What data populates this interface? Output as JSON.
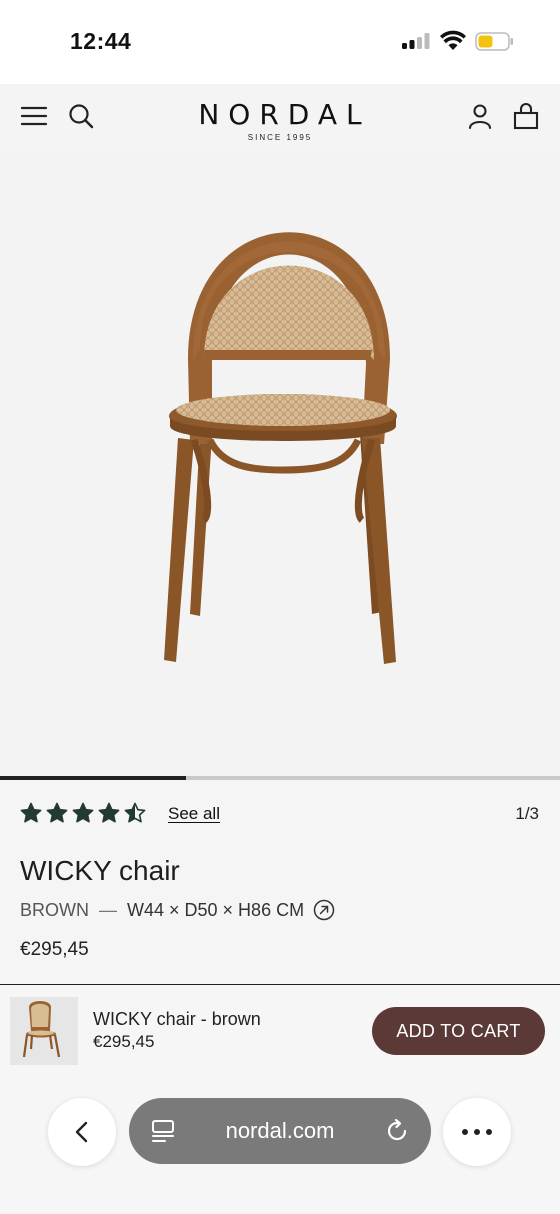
{
  "status_bar": {
    "time": "12:44"
  },
  "header": {
    "brand": "NORDAL",
    "tagline": "SINCE 1995",
    "icons": [
      "menu-icon",
      "search-icon",
      "account-icon",
      "bag-icon"
    ]
  },
  "gallery": {
    "current_page": 1,
    "total_pages": 3,
    "counter": "1/3",
    "progress": 0.333
  },
  "product": {
    "rating": 4.5,
    "rating_max": 5,
    "see_all": "See all",
    "name": "WICKY chair",
    "color": "BROWN",
    "separator": "—",
    "dimensions": "W44 × D50 × H86 CM",
    "price": "€295,45"
  },
  "cart_bar": {
    "name": "WICKY chair - brown",
    "price": "€295,45",
    "button": "ADD TO CART"
  },
  "browser": {
    "url": "nordal.com"
  },
  "colors": {
    "accent": "#5a3936",
    "star": "#233a33",
    "urlbar": "#7a7a7a"
  }
}
